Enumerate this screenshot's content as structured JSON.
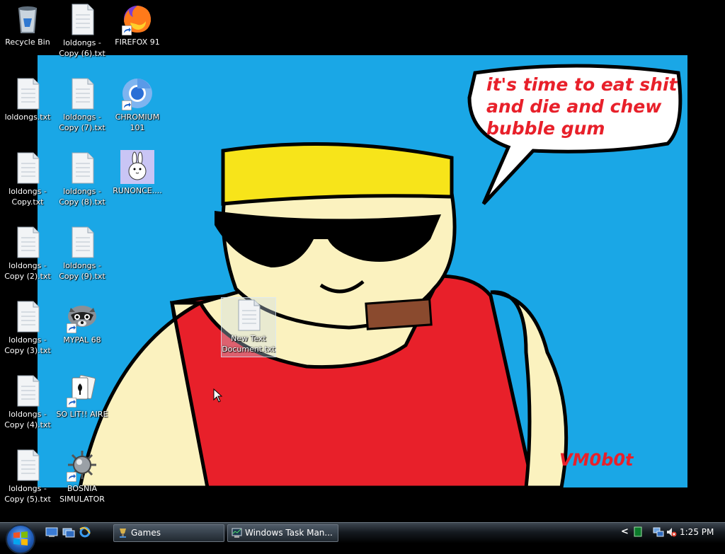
{
  "desktop_icons": [
    {
      "label": "Recycle Bin",
      "icon": "recycle-bin-icon"
    },
    {
      "label": "loldongs - Copy (6).txt",
      "icon": "text-file-icon"
    },
    {
      "label": "FIREFOX 91",
      "icon": "firefox-icon"
    },
    {
      "label": "loldongs.txt",
      "icon": "text-file-icon"
    },
    {
      "label": "loldongs - Copy (7).txt",
      "icon": "text-file-icon"
    },
    {
      "label": "CHROMIUM 101",
      "icon": "chromium-icon"
    },
    {
      "label": "loldongs - Copy.txt",
      "icon": "text-file-icon"
    },
    {
      "label": "loldongs - Copy (8).txt",
      "icon": "text-file-icon"
    },
    {
      "label": "RUNONCE....",
      "icon": "bunny-icon"
    },
    {
      "label": "loldongs - Copy (2).txt",
      "icon": "text-file-icon"
    },
    {
      "label": "loldongs - Copy (9).txt",
      "icon": "text-file-icon"
    },
    {
      "label": "loldongs - Copy (3).txt",
      "icon": "text-file-icon"
    },
    {
      "label": "MYPAL 68",
      "icon": "raccoon-icon"
    },
    {
      "label": "loldongs - Copy (4).txt",
      "icon": "text-file-icon"
    },
    {
      "label": "SO LIT!! AIRE",
      "icon": "solitaire-icon"
    },
    {
      "label": "loldongs - Copy (5).txt",
      "icon": "text-file-icon"
    },
    {
      "label": "BOSNIA SIMULATOR",
      "icon": "mine-icon"
    },
    {
      "label": "New Text Document.txt",
      "icon": "text-file-icon"
    }
  ],
  "wallpaper": {
    "speech_text": "it's time to eat shit and die and chew bubble gum",
    "signature": "VM0b0t",
    "colors": {
      "sky": "#1aa7e6",
      "text": "#e8202a",
      "hair": "#f7e41a",
      "skin": "#fbf2bf",
      "shirt": "#e8202a",
      "cigar": "#8a4a2e"
    }
  },
  "taskbar": {
    "tasks": [
      {
        "label": "Games",
        "icon": "games-icon"
      },
      {
        "label": "Windows Task Man...",
        "icon": "task-manager-icon"
      }
    ],
    "tray_expand": "<",
    "clock": "1:25 PM"
  }
}
